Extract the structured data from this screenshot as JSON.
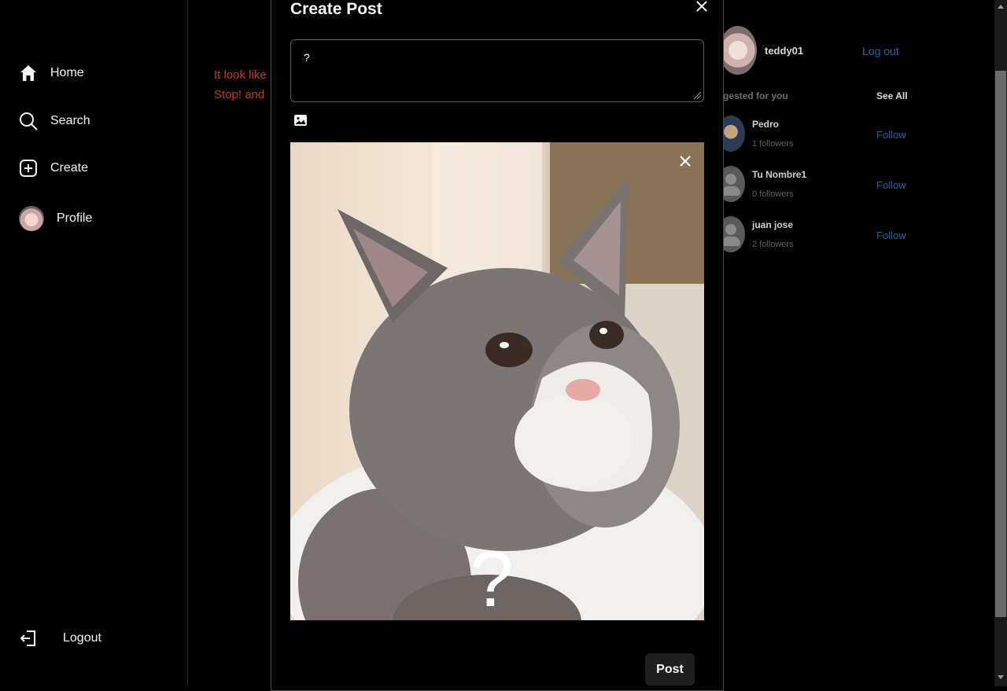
{
  "nav": {
    "home": "Home",
    "search": "Search",
    "create": "Create",
    "profile": "Profile",
    "logout": "Logout"
  },
  "feed": {
    "line1": "It look like",
    "line2": "Stop! and"
  },
  "user": {
    "username": "teddy01",
    "logout_link": "Log out"
  },
  "suggestions": {
    "title": "gested for you",
    "see_all": "See All",
    "items": [
      {
        "name": "Pedro",
        "followers": "1 followers",
        "action": "Follow"
      },
      {
        "name": "Tu Nombre1",
        "followers": "0 followers",
        "action": "Follow"
      },
      {
        "name": "juan jose",
        "followers": "2 followers",
        "action": "Follow"
      }
    ]
  },
  "modal": {
    "title": "Create Post",
    "text_value": "?",
    "post_button": "Post",
    "image_caption": "?"
  },
  "colors": {
    "background": "#000000",
    "error_text": "#c0392b",
    "link": "#2f5d9e"
  }
}
